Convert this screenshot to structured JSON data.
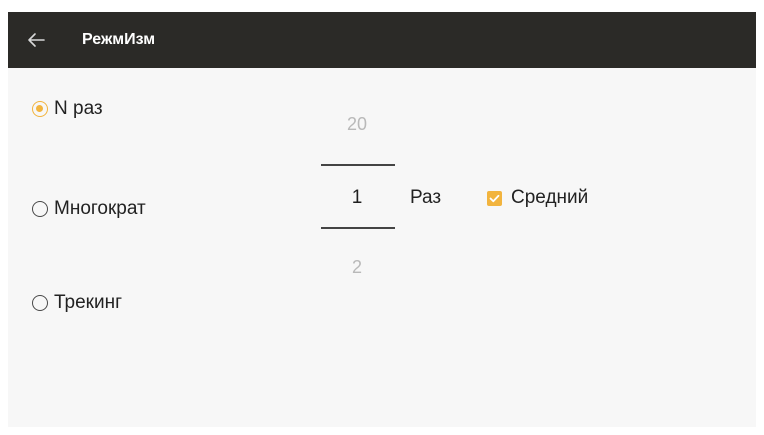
{
  "header": {
    "title": "РежмИзм"
  },
  "icons": {
    "back": "arrow-left-icon"
  },
  "colors": {
    "appbar": "#2b2a27",
    "accent": "#f2b43e",
    "background": "#f7f7f7"
  },
  "mode_options": [
    {
      "label": "N раз",
      "selected": true
    },
    {
      "label": "Многократ",
      "selected": false
    },
    {
      "label": "Трекинг",
      "selected": false
    }
  ],
  "count_picker": {
    "previous": "20",
    "current": "1",
    "next": "2"
  },
  "unit_label": "Раз",
  "average_checkbox": {
    "label": "Средний",
    "checked": true
  }
}
